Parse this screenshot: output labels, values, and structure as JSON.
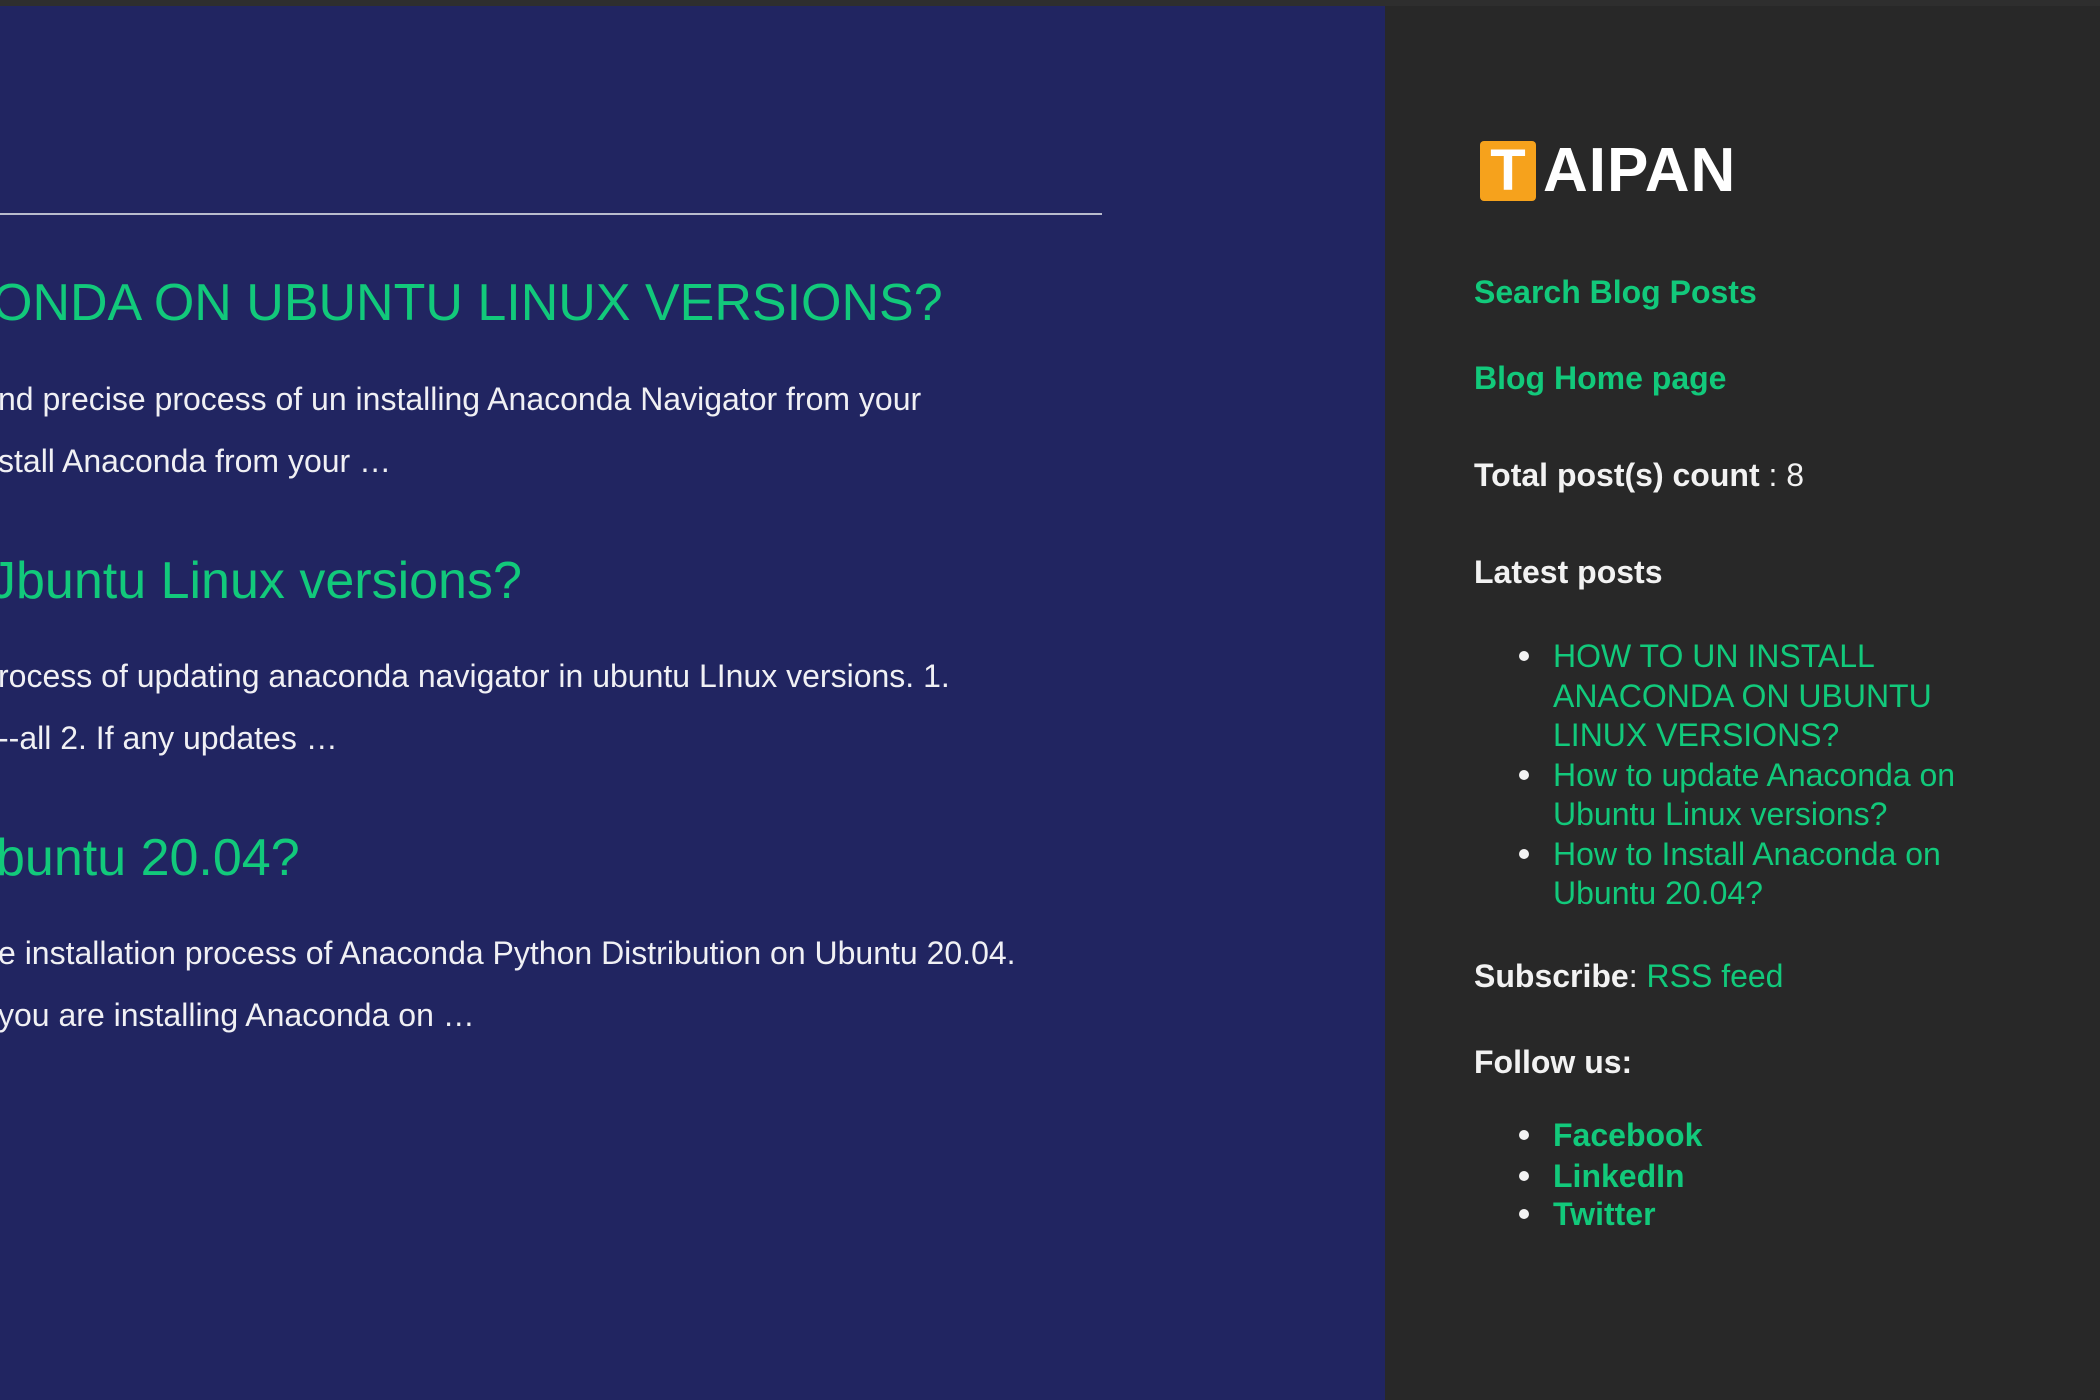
{
  "main": {
    "posts": [
      {
        "title": "ONDA ON UBUNTU LINUX VERSIONS?",
        "excerpt": [
          "nd precise process of un installing Anaconda Navigator from your",
          "stall Anaconda from your …"
        ]
      },
      {
        "title": "Jbuntu Linux versions?",
        "excerpt": [
          "rocess of updating anaconda navigator in ubuntu LInux versions. 1.",
          "--all 2. If any updates …"
        ]
      },
      {
        "title": "buntu 20.04?",
        "excerpt": [
          "e installation process of Anaconda Python Distribution on Ubuntu 20.04.",
          " you are installing Anaconda on …"
        ]
      }
    ]
  },
  "sidebar": {
    "logo": {
      "mark": "T",
      "text": "AIPAN"
    },
    "search_link": "Search Blog Posts",
    "home_link": "Blog Home page",
    "count_label": "Total post(s) count",
    "count_value": " : 8",
    "latest_heading": "Latest posts",
    "latest": [
      {
        "lines": [
          "HOW TO UN INSTALL",
          "ANACONDA ON UBUNTU",
          "LINUX VERSIONS?"
        ]
      },
      {
        "lines": [
          "How to update Anaconda on",
          "Ubuntu Linux versions?"
        ]
      },
      {
        "lines": [
          "How to Install Anaconda on",
          "Ubuntu 20.04?"
        ]
      }
    ],
    "subscribe_label": "Subscribe",
    "subscribe_sep": ": ",
    "rss_link": "RSS feed",
    "follow_heading": "Follow us:",
    "social": [
      "Facebook",
      "LinkedIn",
      "Twitter"
    ]
  },
  "colors": {
    "main_bg": "#212561",
    "sidebar_bg": "#282828",
    "link": "#12c97b",
    "logo_accent": "#f6a21c"
  }
}
